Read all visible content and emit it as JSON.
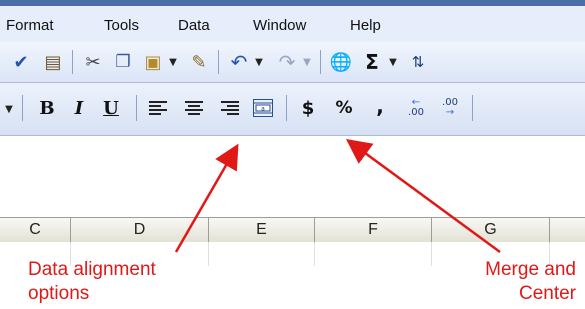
{
  "menu": [
    {
      "label": "Format",
      "underline": "o"
    },
    {
      "label": "Tools",
      "underline": "T"
    },
    {
      "label": "Data",
      "underline": "D"
    },
    {
      "label": "Window",
      "underline": "W"
    },
    {
      "label": "Help",
      "underline": "H"
    }
  ],
  "toolbar": {
    "bold_label": "B",
    "italic_label": "I",
    "underline_label": "U",
    "currency_label": "$",
    "percent_label": "%",
    "comma_label": ",",
    "increase_decimal_label": ".00",
    "decrease_decimal_label": ".00",
    "sum_label": "Σ",
    "merge_label": "a"
  },
  "columns": [
    "C",
    "D",
    "E",
    "F",
    "G"
  ],
  "annotations": {
    "left_line1": "Data alignment",
    "left_line2": "options",
    "right_line1": "Merge and",
    "right_line2": "Center"
  },
  "colors": {
    "annotation": "#e01818",
    "accent": "#1d3d7a"
  }
}
